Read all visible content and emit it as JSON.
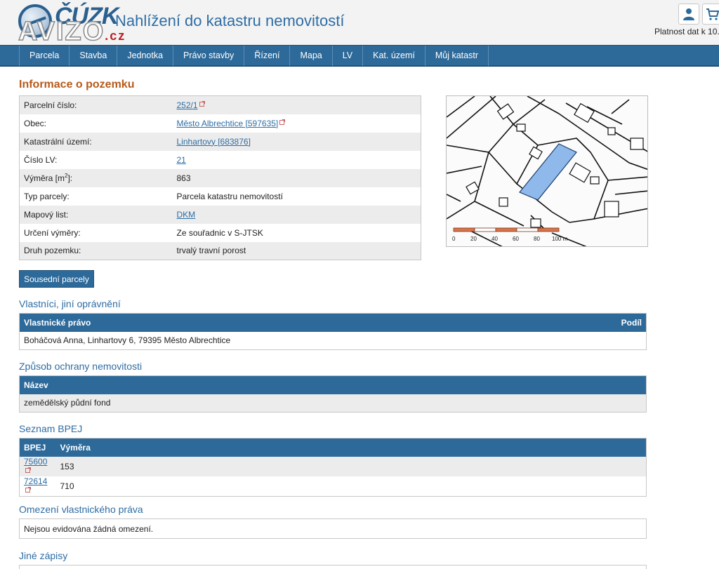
{
  "header": {
    "logo_text": "ČÚZK",
    "watermark_text": "AVIZO",
    "watermark_suffix": ".cz",
    "title": "Nahlížení do katastru nemovitostí",
    "validity_text": "Platnost dat k 10.",
    "user_icon": "user-icon",
    "cart_icon": "cart-icon"
  },
  "nav": {
    "items": [
      "Parcela",
      "Stavba",
      "Jednotka",
      "Právo stavby",
      "Řízení",
      "Mapa",
      "LV",
      "Kat. území",
      "Můj katastr"
    ]
  },
  "parcel": {
    "heading": "Informace o pozemku",
    "rows": [
      {
        "label": "Parcelní číslo:",
        "value": "252/1"
      },
      {
        "label": "Obec:",
        "value": "Město Albrechtice [597635]"
      },
      {
        "label": "Katastrální území:",
        "value": "Linhartovy [683876]"
      },
      {
        "label": "Číslo LV:",
        "value": "21"
      },
      {
        "label": "Výměra [m",
        "label_sup": "2",
        "label_end": "]:",
        "value": "863"
      },
      {
        "label": "Typ parcely:",
        "value": "Parcela katastru nemovitostí"
      },
      {
        "label": "Mapový list:",
        "value": "DKM"
      },
      {
        "label": "Určení výměry:",
        "value": "Ze souřadnic v S-JTSK"
      },
      {
        "label": "Druh pozemku:",
        "value": "trvalý travní porost"
      }
    ]
  },
  "map": {
    "scale_labels": [
      "0",
      "20",
      "40",
      "60",
      "80",
      "100 m"
    ],
    "highlight_color": "#8fb9ea"
  },
  "neighbors_button": "Sousední parcely",
  "owners": {
    "heading": "Vlastníci, jiní oprávnění",
    "col_right": "Vlastnické právo",
    "col_share": "Podíl",
    "row": "Boháčová Anna, Linhartovy 6, 79395 Město Albrechtice"
  },
  "protection": {
    "heading": "Způsob ochrany nemovitosti",
    "col_name": "Název",
    "row": "zemědělský půdní fond"
  },
  "bpej": {
    "heading": "Seznam BPEJ",
    "col_code": "BPEJ",
    "col_area": "Výměra",
    "rows": [
      {
        "code": "75600",
        "area": "153"
      },
      {
        "code": "72614",
        "area": "710"
      }
    ]
  },
  "restrictions": {
    "heading": "Omezení vlastnického práva",
    "text": "Nejsou evidována žádná omezení."
  },
  "other": {
    "heading": "Jiné zápisy"
  },
  "colors": {
    "nav_bg": "#2d6a9a",
    "heading_orange": "#b85a1a",
    "heading_blue": "#2e6da4"
  }
}
